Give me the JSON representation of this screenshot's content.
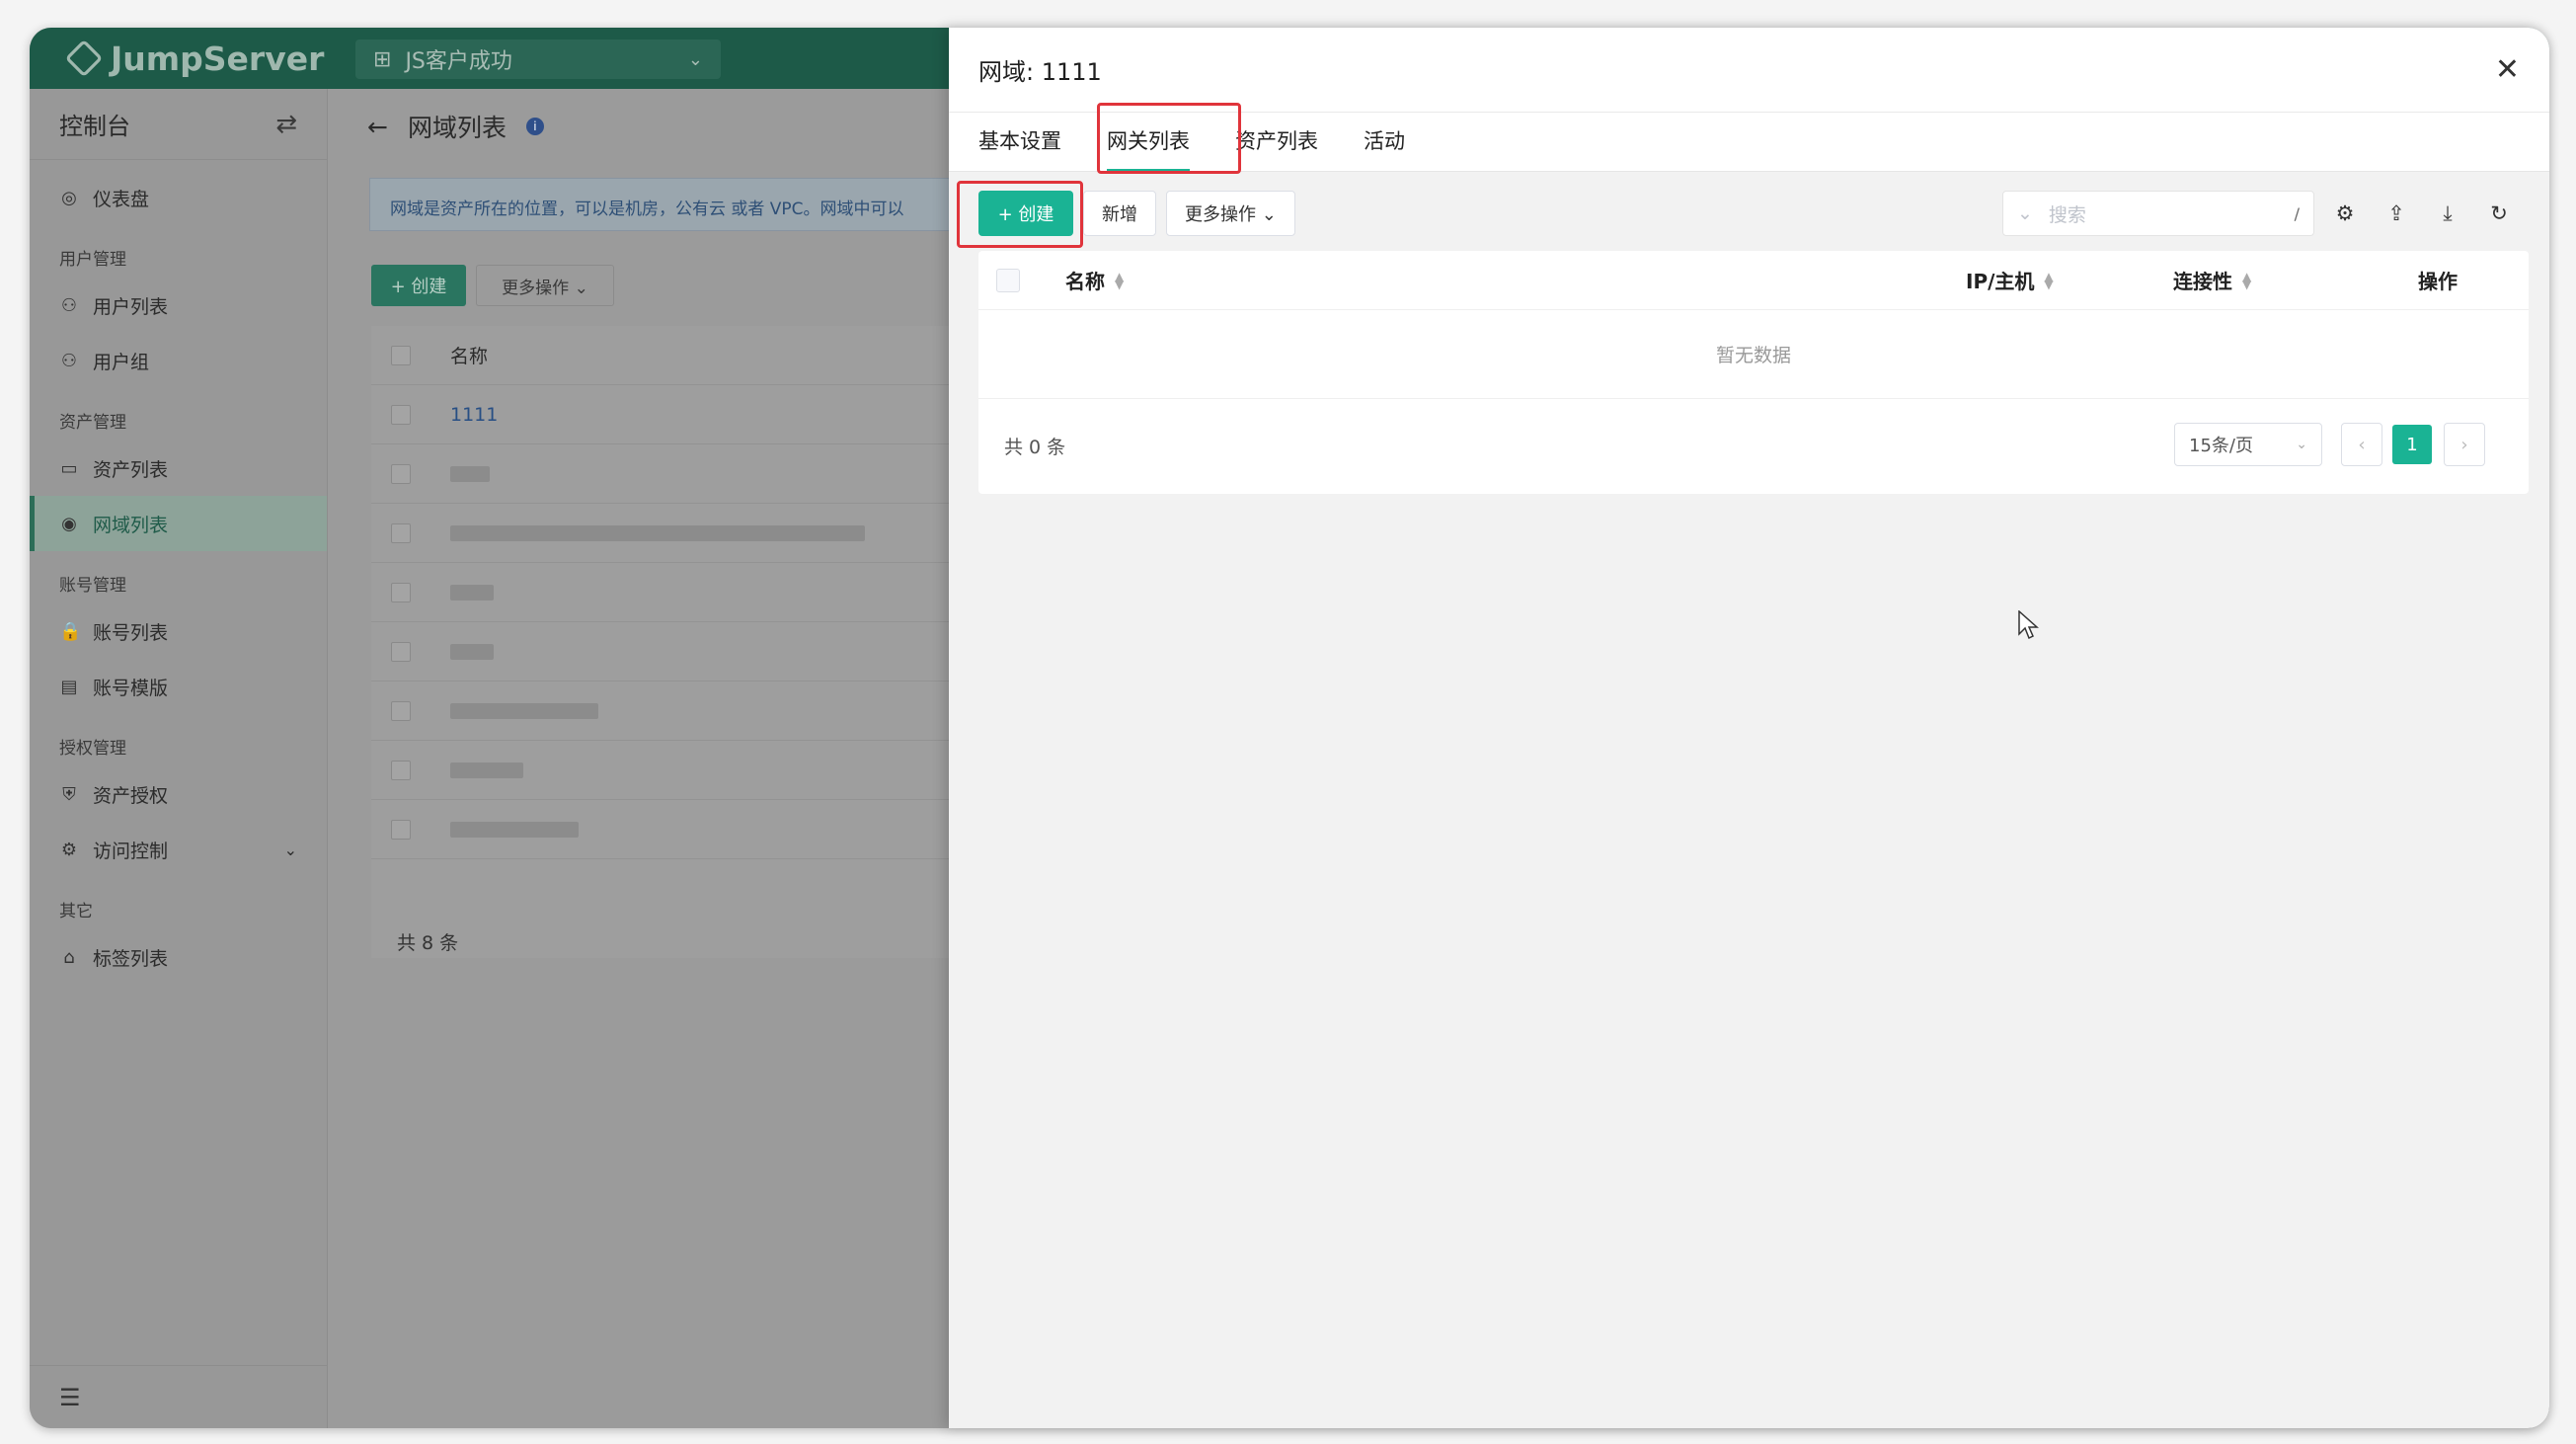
{
  "app": {
    "logo_text": "JumpServer",
    "org": "JS客户成功"
  },
  "sidebar": {
    "title": "控制台",
    "items": [
      {
        "type": "item",
        "label": "仪表盘",
        "icon": "dashboard-icon",
        "glyph": "◎"
      },
      {
        "type": "group",
        "label": "用户管理"
      },
      {
        "type": "item",
        "label": "用户列表",
        "icon": "user-icon",
        "glyph": "⚇"
      },
      {
        "type": "item",
        "label": "用户组",
        "icon": "user-group-icon",
        "glyph": "⚇"
      },
      {
        "type": "group",
        "label": "资产管理"
      },
      {
        "type": "item",
        "label": "资产列表",
        "icon": "monitor-icon",
        "glyph": "▭"
      },
      {
        "type": "item",
        "label": "网域列表",
        "icon": "domain-icon",
        "glyph": "◉",
        "active": true
      },
      {
        "type": "group",
        "label": "账号管理"
      },
      {
        "type": "item",
        "label": "账号列表",
        "icon": "lock-icon",
        "glyph": "🔒"
      },
      {
        "type": "item",
        "label": "账号模版",
        "icon": "template-icon",
        "glyph": "▤"
      },
      {
        "type": "group",
        "label": "授权管理"
      },
      {
        "type": "item",
        "label": "资产授权",
        "icon": "shield-icon",
        "glyph": "⛨"
      },
      {
        "type": "item",
        "label": "访问控制",
        "icon": "access-control-icon",
        "glyph": "⚙",
        "arrow": "⌄"
      },
      {
        "type": "group",
        "label": "其它"
      },
      {
        "type": "item",
        "label": "标签列表",
        "icon": "tag-icon",
        "glyph": "⌂"
      }
    ]
  },
  "background_page": {
    "title": "网域列表",
    "notice": "网域是资产所在的位置，可以是机房，公有云 或者 VPC。网域中可以",
    "create_label": "+ 创建",
    "more_label": "更多操作 ⌄",
    "column_name": "名称",
    "first_row_name": "1111",
    "total": "共 8 条"
  },
  "drawer": {
    "title": "网域: 1111",
    "tabs": [
      "基本设置",
      "网关列表",
      "资产列表",
      "活动"
    ],
    "active_tab": 1,
    "toolbar": {
      "create_label": "+ 创建",
      "add_label": "新增",
      "more_label": "更多操作 ⌄",
      "search_placeholder": "搜索",
      "search_shortcut": "/"
    },
    "table": {
      "columns": [
        "名称",
        "IP/主机",
        "连接性",
        "操作"
      ],
      "empty_text": "暂无数据"
    },
    "pagination": {
      "total": "共 0 条",
      "page_size": "15条/页",
      "current_page": "1"
    }
  },
  "colors": {
    "accent": "#1ab394",
    "highlight": "#e0343b",
    "brand_dark": "#1d5a48"
  }
}
